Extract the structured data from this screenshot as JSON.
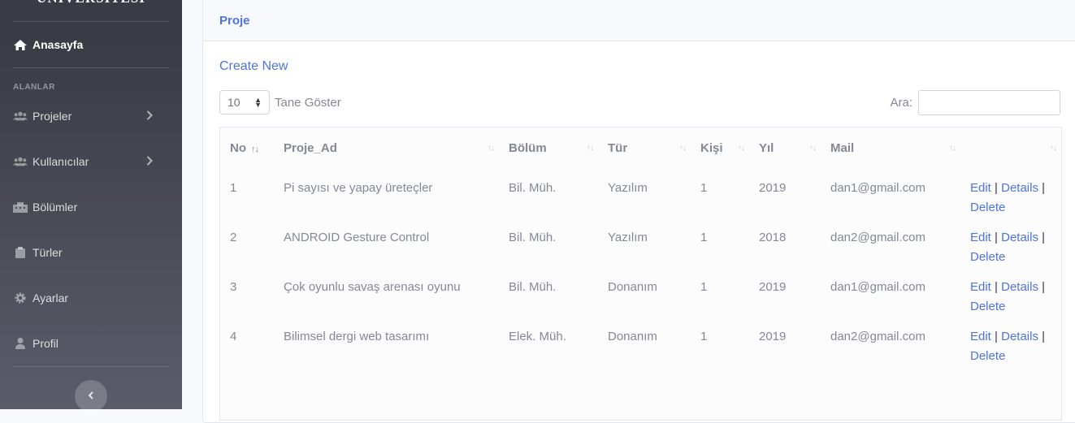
{
  "sidebar": {
    "brand": "ÜNİVERSİTESİ",
    "home": "Anasayfa",
    "heading": "ALANLAR",
    "items": [
      {
        "label": "Projeler",
        "icon": "users-icon",
        "has_chevron": true
      },
      {
        "label": "Kullanıcılar",
        "icon": "users-icon",
        "has_chevron": true
      },
      {
        "label": "Bölümler",
        "icon": "building-icon",
        "has_chevron": false
      },
      {
        "label": "Türler",
        "icon": "clipboard-icon",
        "has_chevron": false
      },
      {
        "label": "Ayarlar",
        "icon": "gear-icon",
        "has_chevron": false
      },
      {
        "label": "Profil",
        "icon": "user-icon",
        "has_chevron": false
      }
    ],
    "toggle": "‹"
  },
  "card": {
    "title": "Proje",
    "create_new": "Create New",
    "length_value": "10",
    "length_suffix": "Tane Göster",
    "search_label": "Ara:",
    "search_value": ""
  },
  "table": {
    "columns": [
      "No",
      "Proje_Ad",
      "Bölüm",
      "Tür",
      "Kişi",
      "Yıl",
      "Mail",
      ""
    ],
    "rows": [
      {
        "no": "1",
        "ad": "Pi sayısı ve yapay üreteçler",
        "bolum": "Bil. Müh.",
        "tur": "Yazılım",
        "kisi": "1",
        "yil": "2019",
        "mail": "dan1@gmail.com"
      },
      {
        "no": "2",
        "ad": "ANDROID Gesture Control",
        "bolum": "Bil. Müh.",
        "tur": "Yazılım",
        "kisi": "1",
        "yil": "2018",
        "mail": "dan2@gmail.com"
      },
      {
        "no": "3",
        "ad": "Çok oyunlu savaş arenası oyunu",
        "bolum": "Bil. Müh.",
        "tur": "Donanım",
        "kisi": "1",
        "yil": "2019",
        "mail": "dan1@gmail.com"
      },
      {
        "no": "4",
        "ad": "Bilimsel dergi web tasarımı",
        "bolum": "Elek. Müh.",
        "tur": "Donanım",
        "kisi": "1",
        "yil": "2019",
        "mail": "dan2@gmail.com"
      }
    ],
    "actions": {
      "edit": "Edit",
      "details": "Details",
      "delete": "Delete",
      "separator": "|"
    }
  },
  "colors": {
    "primary": "#4e73df",
    "sidebar_dark": "#3a3b45",
    "text": "#858796"
  }
}
